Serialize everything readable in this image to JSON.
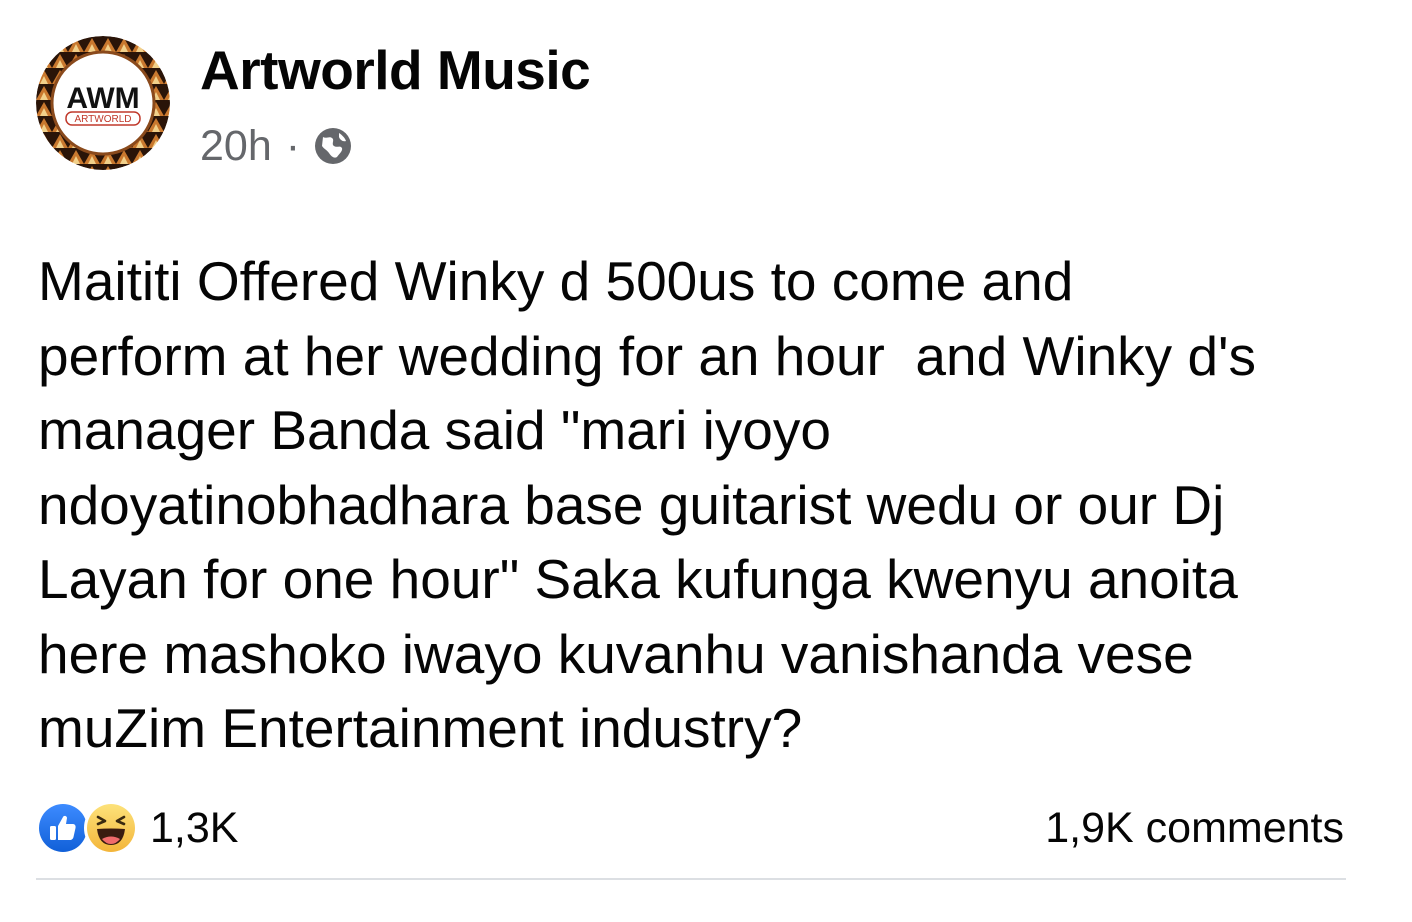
{
  "post": {
    "author": "Artworld Music",
    "avatar_text": "AWM",
    "avatar_subtext": "ARTWORLD",
    "timestamp": "20h",
    "separator": "·",
    "audience_icon": "globe-icon",
    "text": "Maititi Offered Winky d 500us to come and\nperform at her wedding for an hour  and Winky d's\nmanager Banda said \"mari iyoyo\nndoyatinobhadhara base guitarist wedu or our Dj\nLayan for one hour\" Saka kufunga kwenyu anoita\nhere mashoko iwayo kuvanhu vanishanda vese\nmuZim Entertainment industry?",
    "reactions": {
      "icons": [
        "like-icon",
        "haha-icon"
      ],
      "count": "1,3K"
    },
    "comments": "1,9K comments"
  },
  "colors": {
    "like_blue": "#1877f2",
    "haha_yellow": "#f7c542",
    "secondary_text": "#65676b",
    "avatar_ring": "#8a4a1c"
  }
}
